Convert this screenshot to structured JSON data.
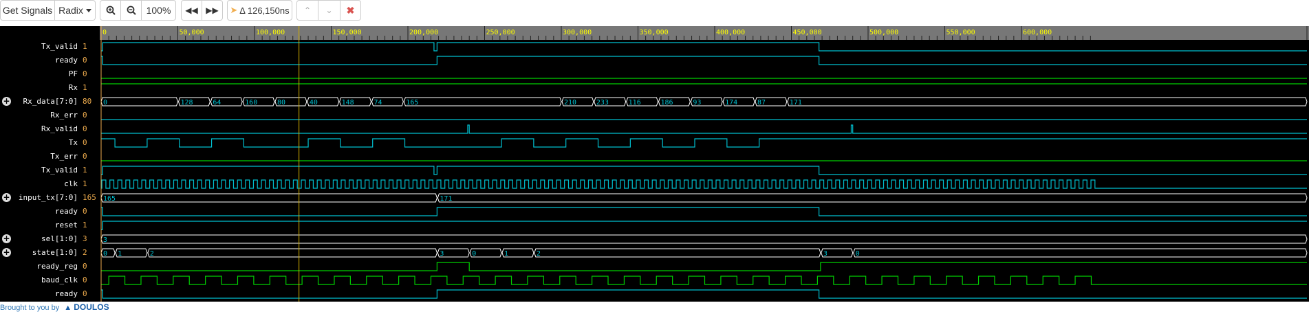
{
  "toolbar": {
    "get_signals": "Get Signals",
    "radix": "Radix",
    "zoom_level": "100%",
    "delta": "Δ 126,150ns"
  },
  "ruler": {
    "ticks": [
      "0",
      "50,000",
      "100,000",
      "150,000",
      "200,000",
      "250,000",
      "300,000",
      "350,000",
      "400,000",
      "450,000",
      "500,000",
      "550,000",
      "600,000"
    ],
    "cursor_time": 129000,
    "marker_time": 0
  },
  "signals": [
    {
      "name": "Tx_valid",
      "value": "1",
      "expand": false
    },
    {
      "name": "ready",
      "value": "0",
      "expand": false
    },
    {
      "name": "PF",
      "value": "0",
      "expand": false
    },
    {
      "name": "Rx",
      "value": "1",
      "expand": false
    },
    {
      "name": "Rx_data[7:0]",
      "value": "80",
      "expand": true
    },
    {
      "name": "Rx_err",
      "value": "0",
      "expand": false
    },
    {
      "name": "Rx_valid",
      "value": "0",
      "expand": false
    },
    {
      "name": "Tx",
      "value": "0",
      "expand": false
    },
    {
      "name": "Tx_err",
      "value": "0",
      "expand": false
    },
    {
      "name": "Tx_valid",
      "value": "1",
      "expand": false
    },
    {
      "name": "clk",
      "value": "1",
      "expand": false
    },
    {
      "name": "input_tx[7:0]",
      "value": "165",
      "expand": true
    },
    {
      "name": "ready",
      "value": "0",
      "expand": false
    },
    {
      "name": "reset",
      "value": "1",
      "expand": false
    },
    {
      "name": "sel[1:0]",
      "value": "3",
      "expand": true
    },
    {
      "name": "state[1:0]",
      "value": "2",
      "expand": true
    },
    {
      "name": "ready_reg",
      "value": "0",
      "expand": false
    },
    {
      "name": "baud_clk",
      "value": "0",
      "expand": false
    },
    {
      "name": "ready",
      "value": "0",
      "expand": false
    }
  ],
  "bus_values": {
    "Rx_data": [
      {
        "t": 0,
        "v": "0"
      },
      {
        "t": 50000,
        "v": "128"
      },
      {
        "t": 71000,
        "v": "64"
      },
      {
        "t": 92000,
        "v": "160"
      },
      {
        "t": 113000,
        "v": "80"
      },
      {
        "t": 134000,
        "v": "40"
      },
      {
        "t": 155000,
        "v": "148"
      },
      {
        "t": 176000,
        "v": "74"
      },
      {
        "t": 197000,
        "v": "165"
      },
      {
        "t": 300000,
        "v": "210"
      },
      {
        "t": 321000,
        "v": "233"
      },
      {
        "t": 342000,
        "v": "116"
      },
      {
        "t": 363000,
        "v": "186"
      },
      {
        "t": 384000,
        "v": "93"
      },
      {
        "t": 405000,
        "v": "174"
      },
      {
        "t": 426000,
        "v": "87"
      },
      {
        "t": 447000,
        "v": "171"
      }
    ],
    "input_tx": [
      {
        "t": 0,
        "v": "165"
      },
      {
        "t": 219000,
        "v": "171"
      }
    ],
    "sel": [
      {
        "t": 0,
        "v": "3"
      }
    ],
    "state": [
      {
        "t": 0,
        "v": "0"
      },
      {
        "t": 9000,
        "v": "1"
      },
      {
        "t": 30000,
        "v": "2"
      },
      {
        "t": 219000,
        "v": "3"
      },
      {
        "t": 240000,
        "v": "0"
      },
      {
        "t": 261000,
        "v": "1"
      },
      {
        "t": 282000,
        "v": "2"
      },
      {
        "t": 469000,
        "v": "3"
      },
      {
        "t": 490000,
        "v": "0"
      }
    ]
  },
  "footer": {
    "text": "Brought to you by",
    "brand": "DOULOS"
  }
}
